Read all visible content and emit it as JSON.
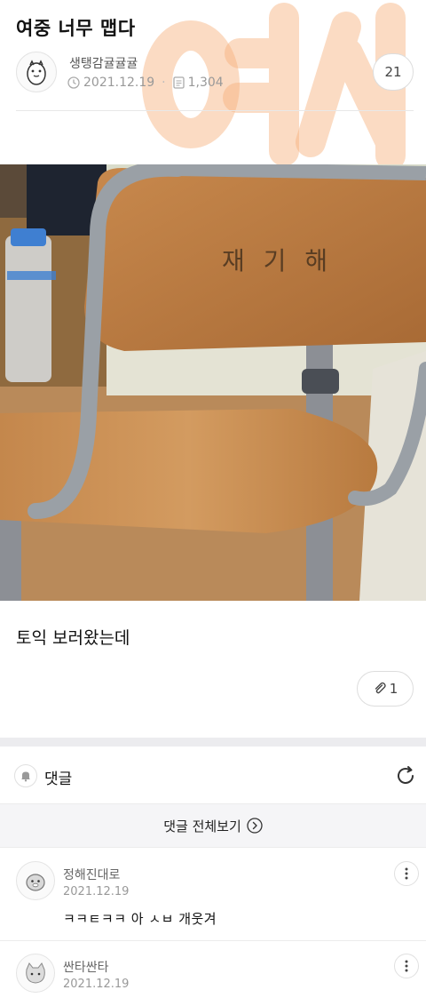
{
  "post": {
    "title": "여중 너무 맵다",
    "author": "생탱감귤귤귤",
    "date": "2021.12.19",
    "views": "1,304",
    "comment_count": "21",
    "watermark_text": "여시",
    "photo_handwriting": "재 기 해",
    "body": "토익 보러왔는데",
    "attachment_count": "1"
  },
  "comments_section": {
    "title": "댓글",
    "view_all_label": "댓글 전체보기"
  },
  "comments": [
    {
      "nickname": "정해진대로",
      "date": "2021.12.19",
      "text": "ㅋㅋㅌㅋㅋ 아 ㅅㅂ 개웃겨"
    },
    {
      "nickname": "싼타싼타",
      "date": "2021.12.19",
      "text": ""
    }
  ],
  "colors": {
    "watermark": "#f6b07a",
    "divider": "#e8e8e8",
    "section_gap": "#ececef"
  },
  "icons": {
    "author_avatar": "character-avatar-icon",
    "clock": "clock-icon",
    "doc": "document-icon",
    "attach": "paperclip-icon",
    "bell": "bell-icon",
    "refresh": "refresh-icon",
    "view_all": "chevron-right-circle-icon",
    "more": "more-vertical-icon"
  }
}
